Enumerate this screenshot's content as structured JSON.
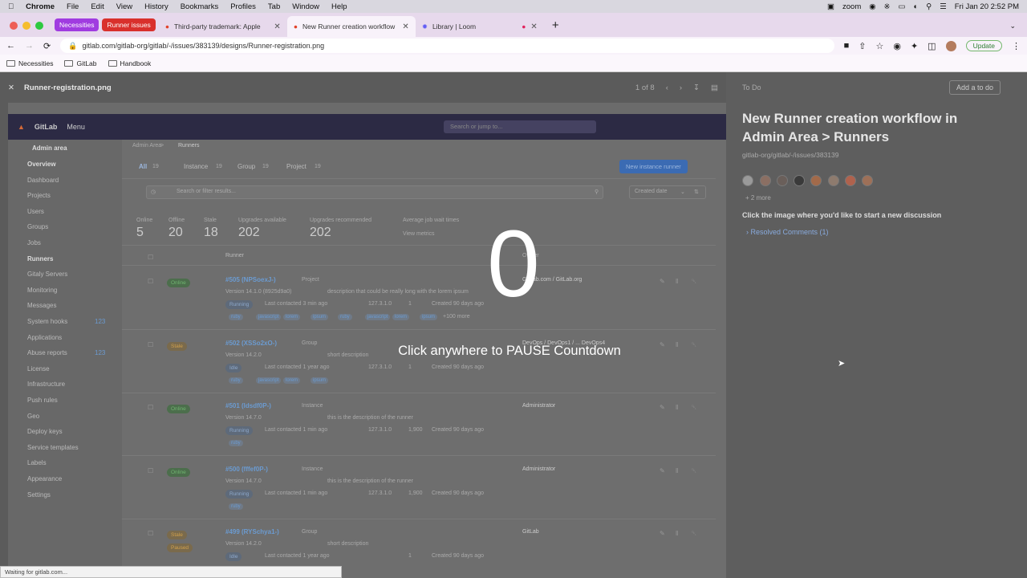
{
  "menubar": {
    "app": "Chrome",
    "items": [
      "File",
      "Edit",
      "View",
      "History",
      "Bookmarks",
      "Profiles",
      "Tab",
      "Window",
      "Help"
    ],
    "zoom": "zoom",
    "clock": "Fri Jan 20  2:52 PM"
  },
  "tabs": {
    "groups": [
      {
        "label": "Necessities",
        "color": "#a03be0"
      },
      {
        "label": "Runner issues",
        "color": "#d9302c"
      }
    ],
    "items": [
      {
        "label": "Third-party trademark: Apple",
        "active": false
      },
      {
        "label": "New Runner creation workflow",
        "active": true
      },
      {
        "label": "Library | Loom",
        "active": false
      }
    ]
  },
  "address": {
    "url": "gitlab.com/gitlab-org/gitlab/-/issues/383139/designs/Runner-registration.png",
    "update_label": "Update"
  },
  "bookmarks": [
    "Necessities",
    "GitLab",
    "Handbook"
  ],
  "viewer": {
    "filename": "Runner-registration.png",
    "pager": "1 of 8"
  },
  "design": {
    "header_menu": "Menu",
    "search_placeholder": "Search or jump to...",
    "admin_area": "Admin area",
    "sidebar": [
      {
        "label": "Overview",
        "bold": true
      },
      {
        "label": "Dashboard"
      },
      {
        "label": "Projects"
      },
      {
        "label": "Users"
      },
      {
        "label": "Groups"
      },
      {
        "label": "Jobs"
      },
      {
        "label": "Runners",
        "bold": true
      },
      {
        "label": "Gitaly Servers"
      },
      {
        "label": "Monitoring"
      },
      {
        "label": "Messages"
      },
      {
        "label": "System hooks",
        "count": "123"
      },
      {
        "label": "Applications"
      },
      {
        "label": "Abuse reports",
        "count": "123"
      },
      {
        "label": "License"
      },
      {
        "label": "Infrastructure"
      },
      {
        "label": "Push rules"
      },
      {
        "label": "Geo"
      },
      {
        "label": "Deploy keys"
      },
      {
        "label": "Service templates"
      },
      {
        "label": "Labels"
      },
      {
        "label": "Appearance"
      },
      {
        "label": "Settings"
      }
    ],
    "breadcrumb": [
      "Admin Area",
      "Runners"
    ],
    "filter_tabs": [
      {
        "label": "All",
        "count": "19"
      },
      {
        "label": "Instance",
        "count": "19"
      },
      {
        "label": "Group",
        "count": "19"
      },
      {
        "label": "Project",
        "count": "19"
      }
    ],
    "new_runner_label": "New instance runner",
    "filter_placeholder": "Search or filter results...",
    "sort_label": "Created date",
    "stats": [
      {
        "label": "Online",
        "value": "5"
      },
      {
        "label": "Offline",
        "value": "20"
      },
      {
        "label": "Stale",
        "value": "18"
      },
      {
        "label": "Upgrades available",
        "value": "202"
      },
      {
        "label": "Upgrades recommended",
        "value": "202"
      },
      {
        "label": "Average job wait times",
        "value": "View metrics"
      }
    ],
    "col_runner": "Runner",
    "col_owner": "Owner",
    "rows": [
      {
        "status": "Online",
        "id": "#505 (NPSoexJ-)",
        "type": "Project",
        "version": "Version 14.1.0 (8925d9a0)",
        "desc": "description that could be really long with the lorem ipsum",
        "state": "Running",
        "contacted": "Last contacted 3 min ago",
        "ip": "127.3.1.0",
        "jobs": "1",
        "created": "Created 90 days ago",
        "tags": [
          "ruby",
          "javascript",
          "lorem",
          "ipsum",
          "ruby",
          "javascript",
          "lorem",
          "ipsum"
        ],
        "more": "+100 more",
        "owner": "GitLab.com / GitLab.org"
      },
      {
        "status": "Stale",
        "id": "#502 (XSSo2xO-)",
        "type": "Group",
        "version": "Version 14.2.0",
        "desc": "short description",
        "state": "Idle",
        "contacted": "Last contacted 1 year ago",
        "ip": "127.3.1.0",
        "jobs": "1",
        "created": "Created 90 days ago",
        "tags": [
          "ruby",
          "javascript",
          "lorem",
          "ipsum"
        ],
        "more": "",
        "owner": "DevOps / DevOps1 / ... DevOps4"
      },
      {
        "status": "Online",
        "id": "#501 (ldsdf0P-)",
        "type": "Instance",
        "version": "Version 14.7.0",
        "desc": "this is the description of the runner",
        "state": "Running",
        "contacted": "Last contacted 1 min ago",
        "ip": "127.3.1.0",
        "jobs": "1,900",
        "created": "Created 90 days ago",
        "tags": [
          "ruby"
        ],
        "more": "",
        "owner": "Administrator"
      },
      {
        "status": "Online",
        "id": "#500 (fffef0P-)",
        "type": "Instance",
        "version": "Version 14.7.0",
        "desc": "this is the description of the runner",
        "state": "Running",
        "contacted": "Last contacted 1 min ago",
        "ip": "127.3.1.0",
        "jobs": "1,900",
        "created": "Created 90 days ago",
        "tags": [
          "ruby"
        ],
        "more": "",
        "owner": "Administrator"
      },
      {
        "status": "Stale",
        "id": "#499 (RYSchya1-)",
        "type": "Group",
        "version": "Version 14.2.0",
        "desc": "short description",
        "state": "Idle",
        "contacted": "Last contacted 1 year ago",
        "ip": "",
        "jobs": "1",
        "created": "Created 90 days ago",
        "tags": [],
        "more": "",
        "owner": "GitLab",
        "paused": "Paused"
      }
    ]
  },
  "panel": {
    "todo_label": "To Do",
    "add_todo": "Add a to do",
    "title": "New Runner creation workflow in Admin Area > Runners",
    "path": "gitlab-org/gitlab/-/issues/383139",
    "more_participants": "+ 2 more",
    "hint": "Click the image where you'd like to start a new discussion",
    "resolved": "Resolved Comments (1)"
  },
  "countdown": {
    "number": "0",
    "text": "Click anywhere to PAUSE Countdown"
  },
  "status_text": "Waiting for gitlab.com..."
}
